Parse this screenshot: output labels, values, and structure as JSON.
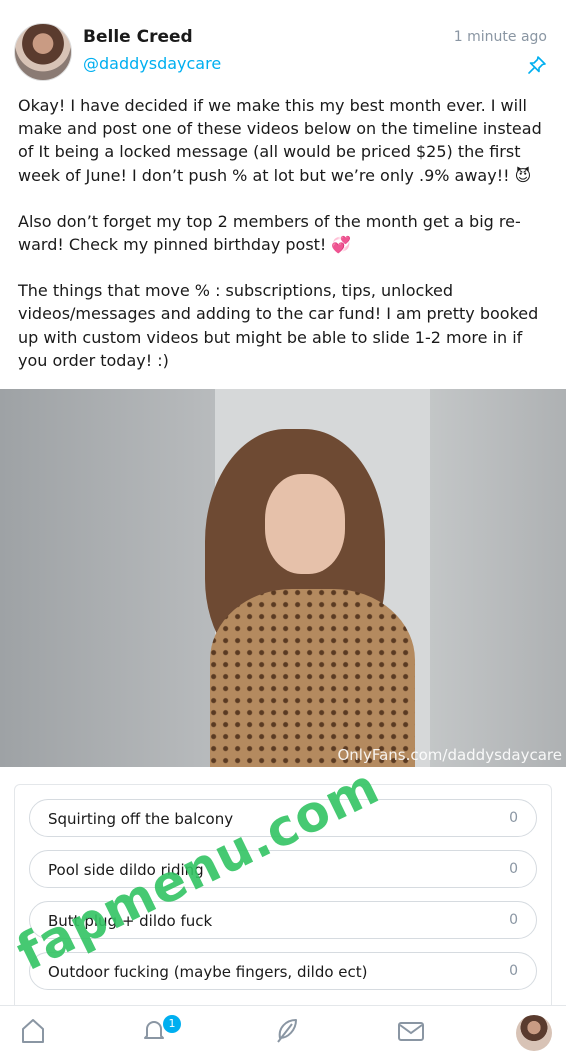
{
  "author": {
    "name": "Belle Creed",
    "handle": "@daddysdaycare",
    "time": "1 minute ago"
  },
  "post": {
    "paragraphs": [
      "Okay! I have decided if we make this my best month ever. I will make and post one of these videos below on the timeline instead of It being a locked message (all would be priced $25) the first week of June! I don’t push % at lot but we’re only .9% away!! 😈",
      "Also don’t forget my top 2 members of the month get a big re-ward! Check my pinned birthday post! 💞",
      "The things that move % : subscriptions, tips, unlocked videos/messages and adding to the car fund! I am pretty booked up with custom videos but might be able to slide 1-2 more in if you order today! :)"
    ]
  },
  "media": {
    "watermark": "OnlyFans.com/daddysdaycare"
  },
  "poll": {
    "options": [
      {
        "label": "Squirting off the balcony",
        "count": "0"
      },
      {
        "label": "Pool side dildo riding",
        "count": "0"
      },
      {
        "label": "Butt plug + dildo fuck",
        "count": "0"
      },
      {
        "label": "Outdoor fucking (maybe fingers, dildo ect)",
        "count": "0"
      }
    ]
  },
  "overlay": {
    "watermark_text": "fapmenu.com"
  },
  "nav": {
    "notifications_badge": "1",
    "icons": [
      "home-icon",
      "bell-icon",
      "feather-icon",
      "mail-icon",
      "profile-avatar"
    ]
  },
  "colors": {
    "accent": "#00aff0",
    "muted": "#8a96a3",
    "overlay_green": "#33c463"
  }
}
